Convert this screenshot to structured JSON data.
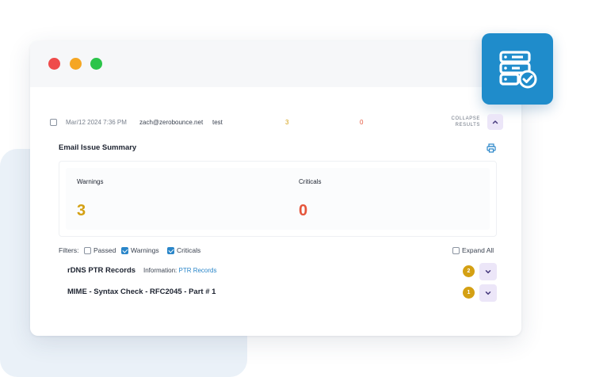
{
  "window": {
    "traffic_lights": [
      "close",
      "minimize",
      "maximize"
    ]
  },
  "app_badge": {
    "icon": "server-check-icon",
    "color": "#1f8ccb"
  },
  "result_row": {
    "date": "Mar/12 2024 7:36 PM",
    "email": "zach@zerobounce.net",
    "name": "test",
    "warnings_count": "3",
    "criticals_count": "0",
    "collapse_label_line1": "COLLAPSE",
    "collapse_label_line2": "RESULTS"
  },
  "summary": {
    "title": "Email Issue Summary",
    "warnings_label": "Warnings",
    "warnings_value": "3",
    "criticals_label": "Criticals",
    "criticals_value": "0",
    "colors": {
      "warning": "#d4a013",
      "critical": "#e5553b"
    }
  },
  "filters": {
    "label": "Filters:",
    "passed": "Passed",
    "warnings": "Warnings",
    "criticals": "Criticals",
    "expand_all": "Expand All",
    "state": {
      "passed": false,
      "warnings": true,
      "criticals": true,
      "expand_all": false
    }
  },
  "issues": [
    {
      "title": "rDNS PTR Records",
      "info_label": "Information:",
      "info_link": "PTR Records",
      "count": "2"
    },
    {
      "title": "MIME - Syntax Check - RFC2045 - Part # 1",
      "count": "1"
    }
  ]
}
